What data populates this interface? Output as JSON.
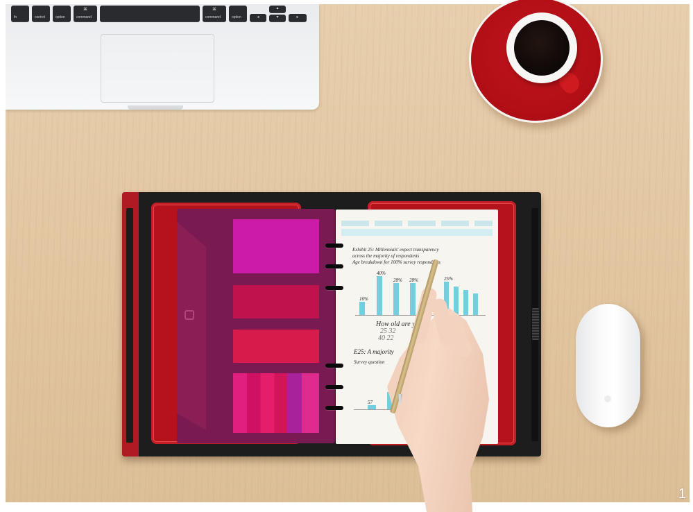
{
  "keyboard": {
    "keys": [
      "fn",
      "control",
      "option",
      "command",
      "command",
      "option"
    ]
  },
  "notebook": {
    "heading_line1": "Exhibit 25: Millennials' expect transparency",
    "heading_line2": "across the majority of respondents",
    "heading_line3": "Age breakdown for 100% survey respondents",
    "bar_labels": [
      "40%",
      "28%",
      "28%",
      "25%",
      "16%"
    ],
    "note_line1": "How old are you?",
    "note_line2": "25   32",
    "note_line3": "40   22",
    "exhibit_b_line1": "E25: A majority",
    "exhibit_b_line2": "Survey question",
    "small_label": "57"
  },
  "page_number": "1"
}
